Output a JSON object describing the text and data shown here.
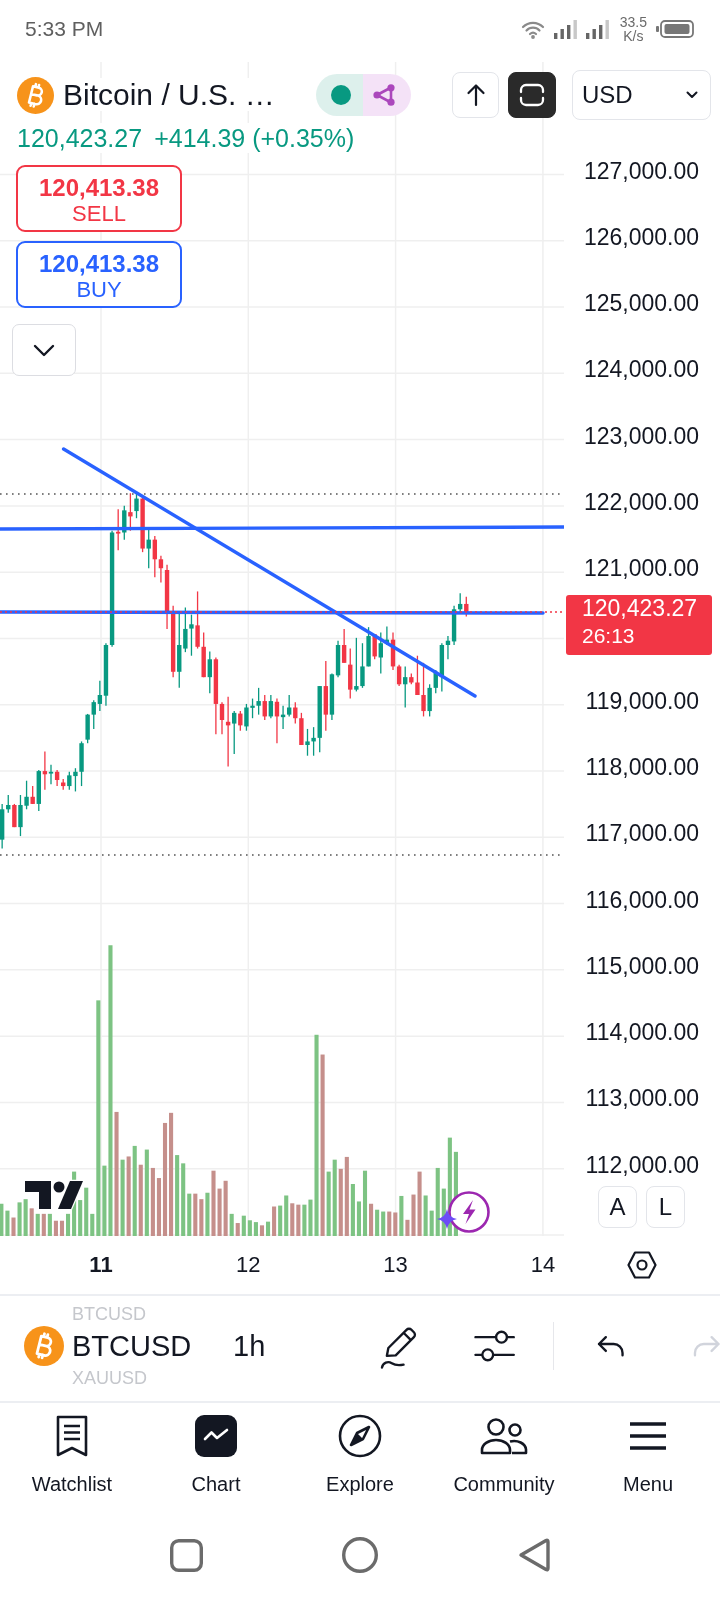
{
  "status_bar": {
    "time": "5:33 PM",
    "speed": "33.5",
    "speed_unit": "K/s"
  },
  "header": {
    "title": "Bitcoin / U.S. …",
    "currency": "USD",
    "last_price": "120,423.27",
    "change": "+414.39 (+0.35%)"
  },
  "trade_buttons": [
    {
      "kind": "sell",
      "price": "120,413.38",
      "label": "SELL"
    },
    {
      "kind": "buy",
      "price": "120,413.38",
      "label": "BUY"
    }
  ],
  "chart": {
    "price_scale_above": [
      "127,000.00",
      "126,000.00",
      "125,000.00",
      "124,000.00",
      "123,000.00",
      "122,000.00",
      "121,000.00"
    ],
    "current_price": {
      "price": "120,423.27",
      "countdown": "26:13"
    },
    "price_scale_below": [
      "119,000.00",
      "118,000.00",
      "117,000.00",
      "116,000.00",
      "115,000.00",
      "114,000.00",
      "113,000.00",
      "112,000.00"
    ],
    "time_scale": [
      {
        "label": "11",
        "bold": true
      },
      {
        "label": "12",
        "bold": false
      },
      {
        "label": "13",
        "bold": false
      },
      {
        "label": "14",
        "bold": false
      }
    ],
    "scale_buttons": [
      "A",
      "L"
    ]
  },
  "toolbar": {
    "symbols": [
      {
        "label": "BTCUSD",
        "selected": false
      },
      {
        "label": "BTCUSD",
        "selected": true
      },
      {
        "label": "XAUUSD",
        "selected": false
      }
    ],
    "interval": "1h",
    "undo": {
      "disabled": false
    },
    "redo": {
      "disabled": true
    }
  },
  "bottom_nav": [
    {
      "label": "Watchlist",
      "selected": false
    },
    {
      "label": "Chart",
      "selected": true
    },
    {
      "label": "Explore",
      "selected": false
    },
    {
      "label": "Community",
      "selected": false
    },
    {
      "label": "Menu",
      "selected": false
    }
  ]
}
